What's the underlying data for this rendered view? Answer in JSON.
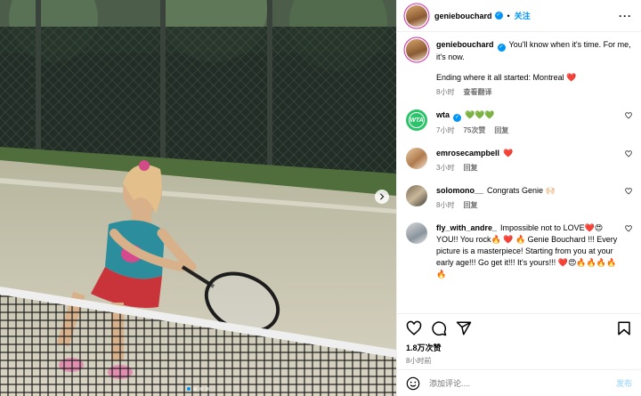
{
  "post": {
    "username": "geniebouchard",
    "follow_label": "关注",
    "more_label": "···"
  },
  "caption": {
    "username": "geniebouchard",
    "text": "You'll know when it's time. For me, it's now.",
    "text2": "Ending where it all started: Montreal ❤️",
    "time": "8小时",
    "translate": "查看翻译"
  },
  "comments": [
    {
      "username": "wta",
      "text": "💚💚💚",
      "time": "7小时",
      "likes": "75次赞",
      "reply": "回复",
      "avatar": "wta-logo"
    },
    {
      "username": "emrosecampbell",
      "text": "❤️",
      "time": "3小时",
      "reply": "回复",
      "avatar": "emrose-avatar"
    },
    {
      "username": "solomono__",
      "text": "Congrats Genie 🙌🏻",
      "time": "8小时",
      "reply": "回复",
      "avatar": "solomono-avatar"
    },
    {
      "username": "fly_with_andre_",
      "text": "Impossible not to LOVE❤️😍 YOU!! You rock🔥 ❤️ 🔥 Genie Bouchard !!! Every picture is a masterpiece! Starting from you at your early age!!! Go get it!!! It's yours!!! ❤️😍🔥🔥🔥🔥🔥",
      "avatar": "fly-avatar"
    }
  ],
  "likes_count": "1.8万次赞",
  "posted_ago": "8小时前",
  "add_comment": {
    "placeholder": "添加评论....",
    "post_label": "发布"
  },
  "colors": {
    "accent": "#0095f6",
    "heart": "#ed4956",
    "wta": "#2bc46b"
  },
  "icons": [
    "heart-icon",
    "comment-icon",
    "share-icon",
    "bookmark-icon",
    "emoji-icon",
    "verified-icon",
    "chevron-right-icon"
  ]
}
